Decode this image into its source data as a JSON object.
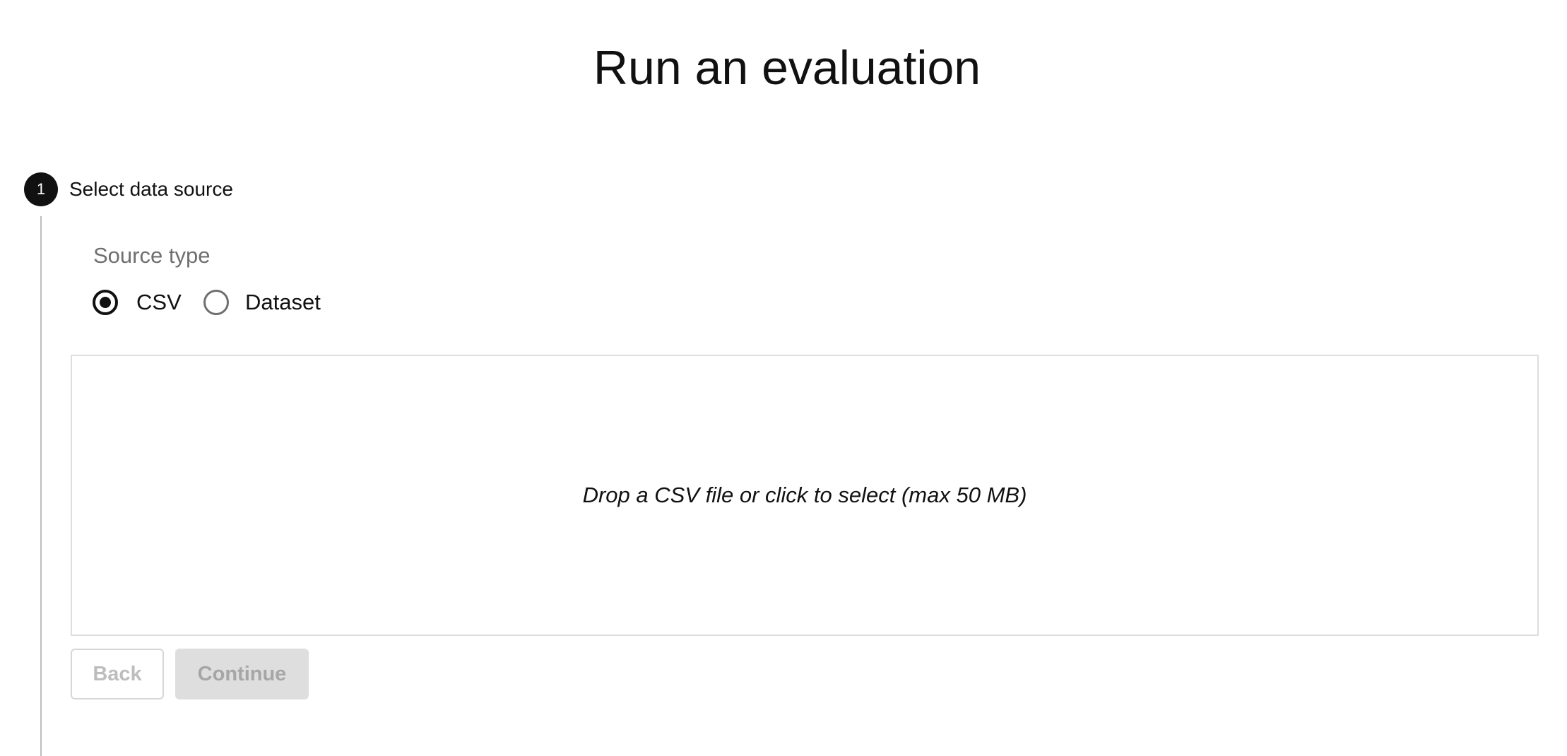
{
  "page": {
    "title": "Run an evaluation"
  },
  "step": {
    "number": "1",
    "title": "Select data source"
  },
  "source_type": {
    "label": "Source type",
    "options": [
      {
        "label": "CSV",
        "selected": true
      },
      {
        "label": "Dataset",
        "selected": false
      }
    ]
  },
  "dropzone": {
    "text": "Drop a CSV file or click to select (max 50 MB)"
  },
  "actions": {
    "back_label": "Back",
    "continue_label": "Continue"
  },
  "colors": {
    "primary": "#111111",
    "muted_text": "#6f6f6f",
    "disabled_text": "#bdbdbd",
    "disabled_bg": "#dedede",
    "border": "#dedede"
  }
}
